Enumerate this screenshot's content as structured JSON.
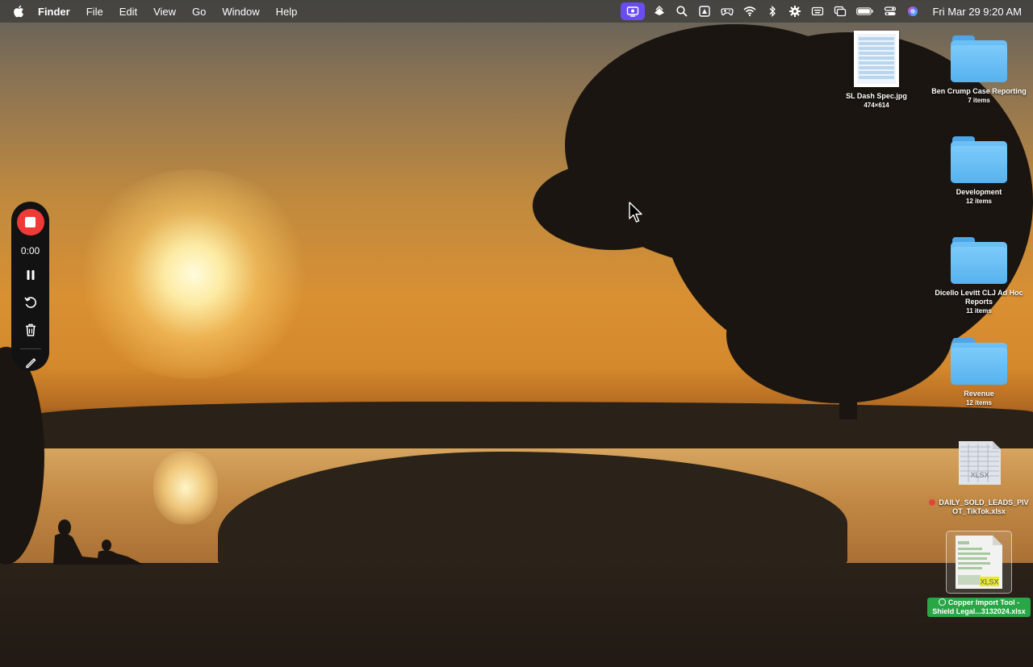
{
  "menubar": {
    "app_name": "Finder",
    "menus": [
      "File",
      "Edit",
      "View",
      "Go",
      "Window",
      "Help"
    ],
    "status_icons": [
      "screen-record-icon",
      "sidebar-app-icon",
      "search-icon",
      "drive-icon",
      "gamepad-icon",
      "wifi-icon",
      "bluetooth-icon",
      "gear-icon",
      "keyboard-icon",
      "screen-mirror-icon",
      "battery-icon",
      "control-center-icon",
      "siri-icon"
    ],
    "clock": "Fri Mar 29  9:20 AM"
  },
  "recorder": {
    "time": "0:00",
    "accent_color": "#ef3b37"
  },
  "desktop": {
    "items": [
      {
        "label": "SL Dash Spec.jpg",
        "sub": "474×614"
      },
      {
        "label": "Ben Crump Case Reporting",
        "sub": "7 items"
      },
      {
        "label": "Development",
        "sub": "12 items"
      },
      {
        "label": "Dicello Levitt CLJ Ad Hoc Reports",
        "sub": "11 items"
      },
      {
        "label": "Revenue",
        "sub": "12 items"
      },
      {
        "label": "DAILY_SOLD_LEADS_PIVOT_TikTok.xlsx",
        "sub": "",
        "badge": "XLSX",
        "tag_color": "#e2453d"
      },
      {
        "label": "Copper Import Tool - Shield Legal...3132024.xlsx",
        "sub": "",
        "badge": "XLSX",
        "selected": true
      }
    ]
  },
  "colors": {
    "menubar": "#3c3a37",
    "folder": "#5fb6f0",
    "record_button": "#ef3b37",
    "selection": "#29a645"
  }
}
